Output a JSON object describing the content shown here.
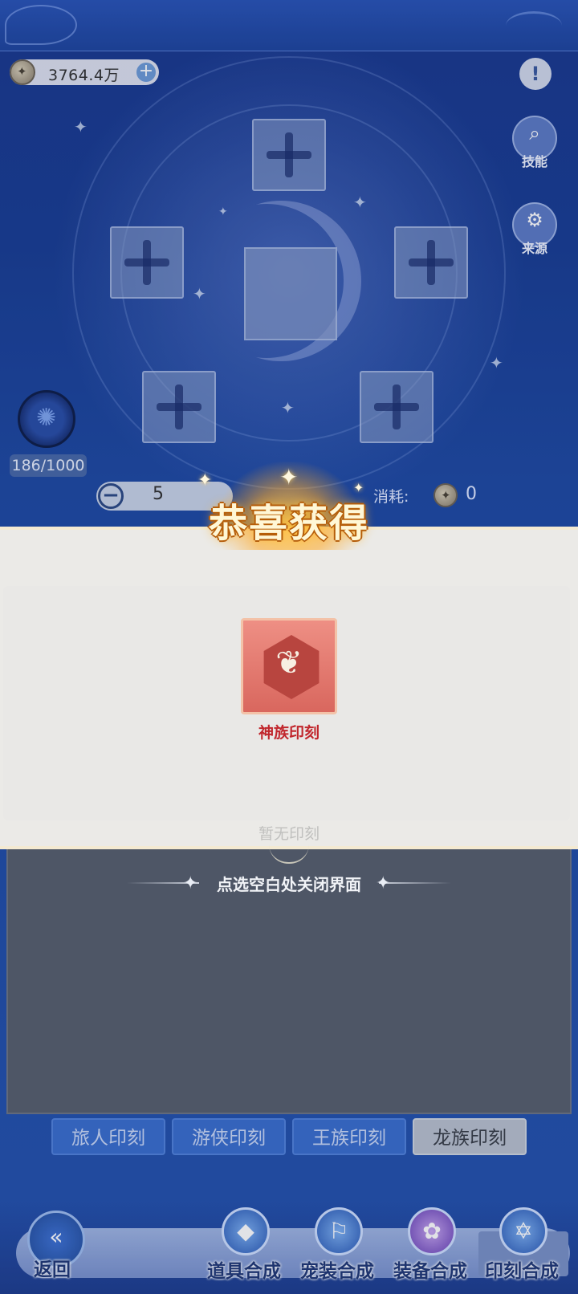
{
  "header": {
    "currency_amount": "3764.4万",
    "currency_add": "+"
  },
  "side_buttons": {
    "info_glyph": "!",
    "skill_label": "技能",
    "source_label": "来源"
  },
  "progress": {
    "text": "186/1000",
    "current": 186,
    "max": 1000
  },
  "quantity": {
    "minus": "−",
    "value": "5"
  },
  "cost": {
    "label": "消耗:",
    "value": "0"
  },
  "reward_modal": {
    "title": "恭喜获得",
    "item_name": "神族印刻",
    "ghost_text": "暂无印刻",
    "close_hint": "点选空白处关闭界面"
  },
  "tabs": [
    {
      "label": "旅人印刻",
      "active": false
    },
    {
      "label": "游侠印刻",
      "active": false
    },
    {
      "label": "王族印刻",
      "active": false
    },
    {
      "label": "龙族印刻",
      "active": true
    }
  ],
  "bottom_nav": {
    "back": "返回",
    "items": [
      {
        "label": "道具合成",
        "icon": "crystal-icon",
        "active": false
      },
      {
        "label": "宠装合成",
        "icon": "pet-gear-icon",
        "active": false
      },
      {
        "label": "装备合成",
        "icon": "equipment-icon",
        "active": false
      },
      {
        "label": "印刻合成",
        "icon": "seal-icon",
        "active": true
      }
    ]
  },
  "colors": {
    "accent": "#3b6fcf",
    "reward_text": "#c1272d",
    "banner_glow": "#ffb43c"
  }
}
